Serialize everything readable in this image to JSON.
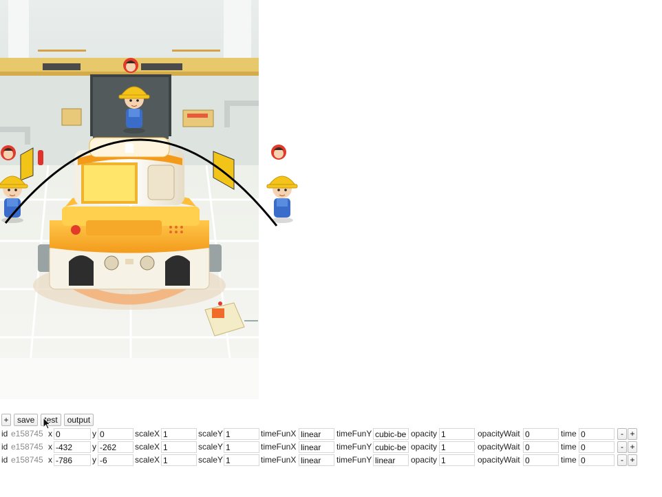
{
  "toolbar": {
    "add_label": "+",
    "save_label": "save",
    "test_label": "test",
    "output_label": "output"
  },
  "rows": [
    {
      "id_label": "id",
      "id_value": "e158745",
      "x_label": "x",
      "x_value": "0",
      "y_label": "y",
      "y_value": "0",
      "scaleX_label": "scaleX",
      "scaleX_value": "1",
      "scaleY_label": "scaleY",
      "scaleY_value": "1",
      "timeFunX_label": "timeFunX",
      "timeFunX_value": "linear",
      "timeFunY_label": "timeFunY",
      "timeFunY_value": "cubic-be",
      "opacity_label": "opacity",
      "opacity_value": "1",
      "opacityWait_label": "opacityWait",
      "opacityWait_value": "0",
      "time_label": "time",
      "time_value": "0",
      "minus_label": "-",
      "plus_label": "+"
    },
    {
      "id_label": "id",
      "id_value": "e158745",
      "x_label": "x",
      "x_value": "-432",
      "y_label": "y",
      "y_value": "-262",
      "scaleX_label": "scaleX",
      "scaleX_value": "1",
      "scaleY_label": "scaleY",
      "scaleY_value": "1",
      "timeFunX_label": "timeFunX",
      "timeFunX_value": "linear",
      "timeFunY_label": "timeFunY",
      "timeFunY_value": "cubic-be",
      "opacity_label": "opacity",
      "opacity_value": "1",
      "opacityWait_label": "opacityWait",
      "opacityWait_value": "0",
      "time_label": "time",
      "time_value": "0",
      "minus_label": "-",
      "plus_label": "+"
    },
    {
      "id_label": "id",
      "id_value": "e158745",
      "x_label": "x",
      "x_value": "-786",
      "y_label": "y",
      "y_value": "-6",
      "scaleX_label": "scaleX",
      "scaleX_value": "1",
      "scaleY_label": "scaleY",
      "scaleY_value": "1",
      "timeFunX_label": "timeFunX",
      "timeFunX_value": "linear",
      "timeFunY_label": "timeFunY",
      "timeFunY_value": "linear",
      "opacity_label": "opacity",
      "opacity_value": "1",
      "opacityWait_label": "opacityWait",
      "opacityWait_value": "0",
      "time_label": "time",
      "time_value": "0",
      "minus_label": "-",
      "plus_label": "+"
    }
  ],
  "scene": {
    "icons": [
      "factory-machine-icon",
      "worker-icon",
      "avatar-badge-icon",
      "control-box-icon",
      "fire-extinguisher-icon"
    ],
    "colors": {
      "machine_orange": "#f7a823",
      "machine_yellow": "#ffd54a",
      "wall": "#e6ebe8",
      "trim": "#e7c86b",
      "path": "#000000"
    }
  }
}
